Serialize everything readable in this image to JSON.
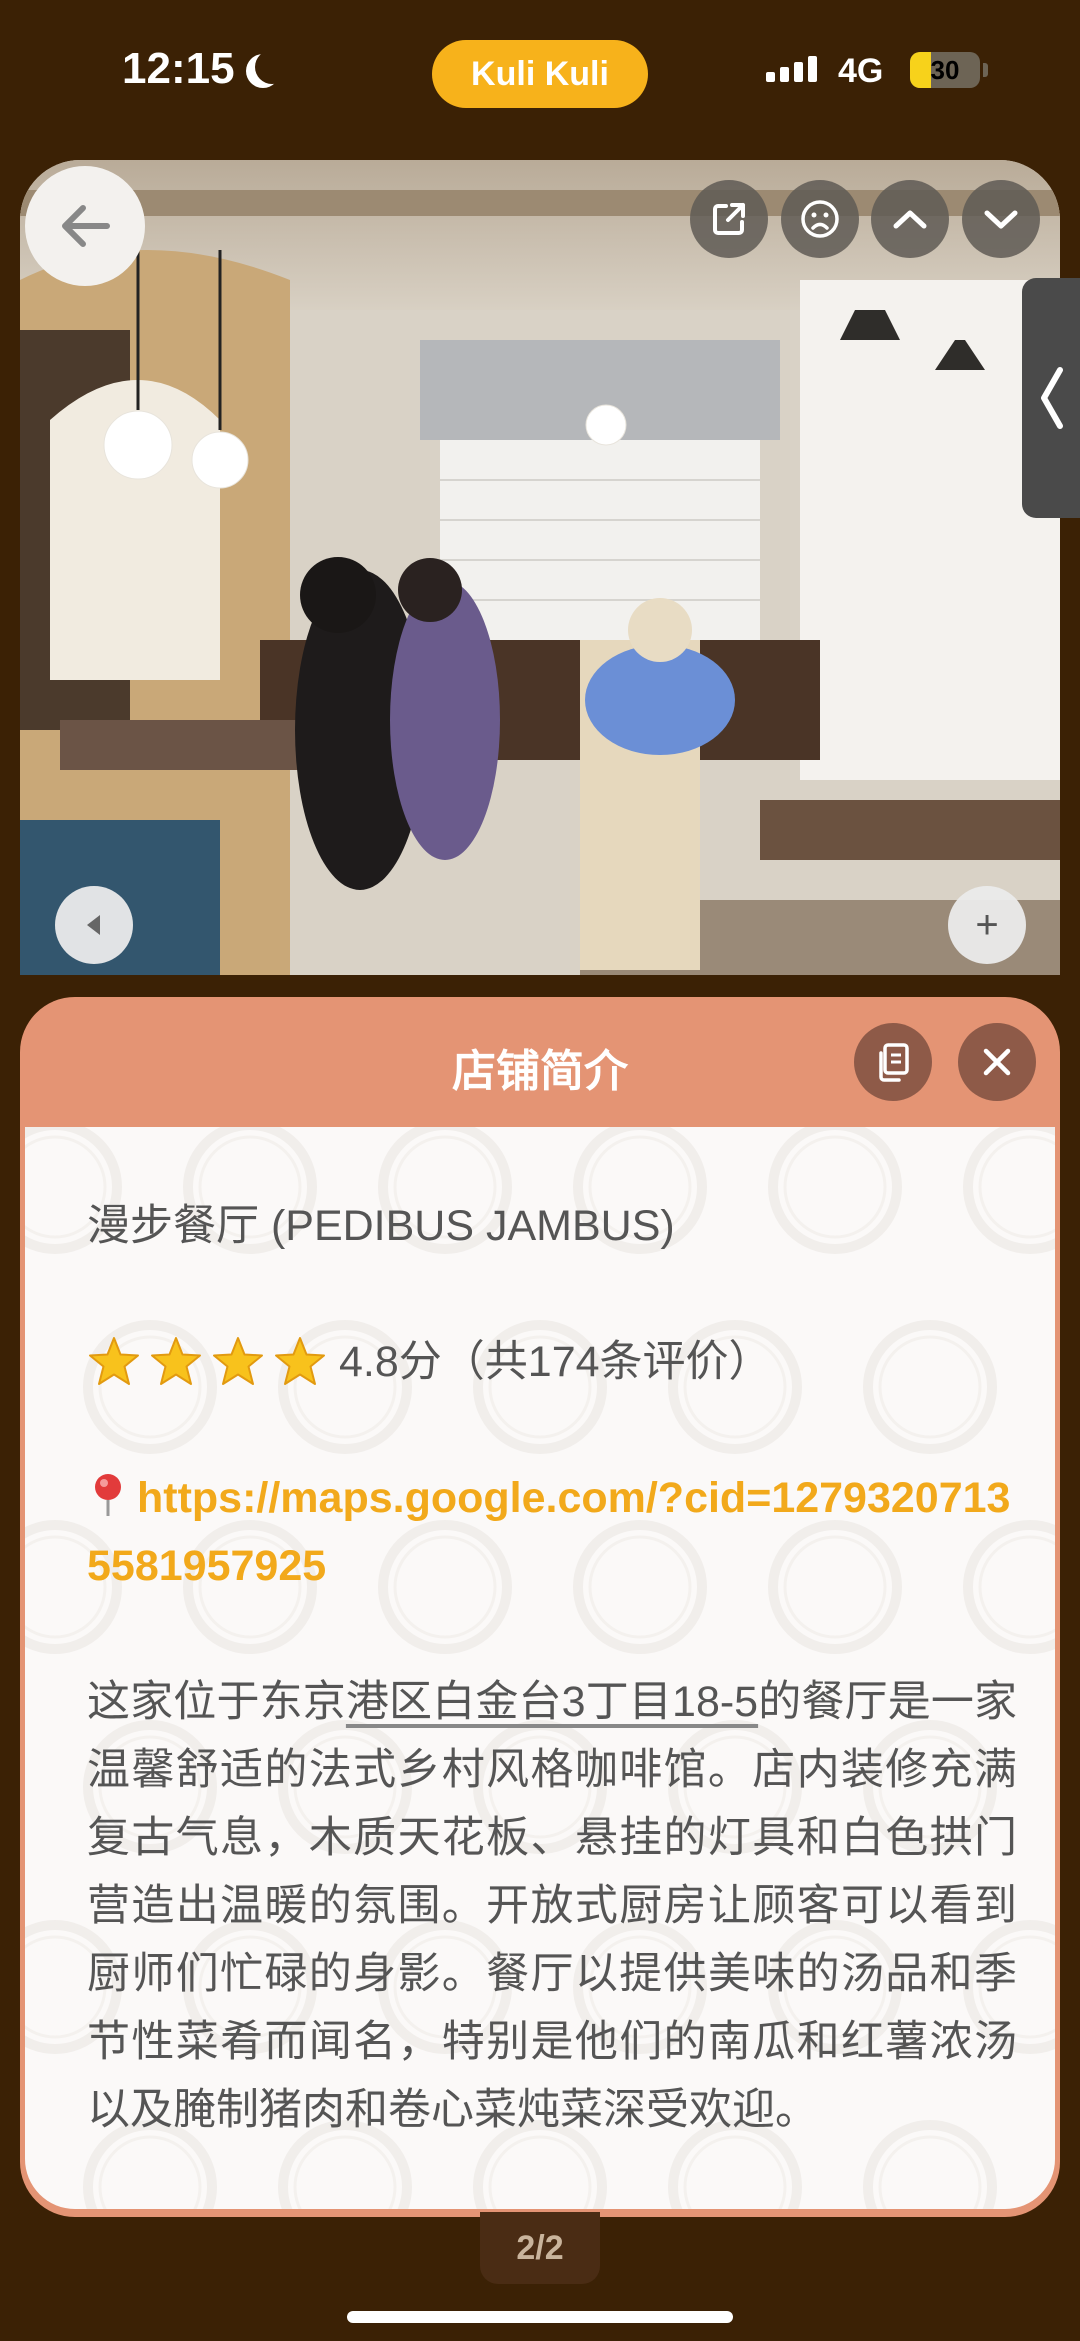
{
  "status_bar": {
    "time": "12:15",
    "app_name": "Kuli Kuli",
    "network": "4G",
    "battery": "30",
    "battery_level": 0.3
  },
  "photo": {
    "icons": [
      "back-arrow-icon",
      "share-icon",
      "sad-face-icon",
      "chevron-up-icon",
      "chevron-down-icon",
      "chevron-left-icon",
      "triangle-left-icon",
      "plus-icon"
    ],
    "plus_label": "+"
  },
  "panel": {
    "title": "店铺简介",
    "shop_name": "漫步餐厅 (PEDIBUS JAMBUS)",
    "stars": 4,
    "rating_text": "4.8分（共174条评价）",
    "map_link": "https://maps.google.com/?cid=12793207135581957925",
    "description_prefix": "这家位于东京",
    "description_address": "港区白金台3丁目18-5",
    "description_rest": "的餐厅是一家温馨舒适的法式乡村风格咖啡馆。店内装修充满复古气息，木质天花板、悬挂的灯具和白色拱门营造出温暖的氛围。开放式厨房让顾客可以看到厨师们忙碌的身影。餐厅以提供美味的汤品和季节性菜肴而闻名，特别是他们的南瓜和红薯浓汤以及腌制猪肉和卷心菜炖菜深受欢迎。"
  },
  "pager": "2/2",
  "colors": {
    "background": "#3b2105",
    "accent": "#f7b21b",
    "panel_header": "#e49474",
    "link": "#f2a91b"
  }
}
